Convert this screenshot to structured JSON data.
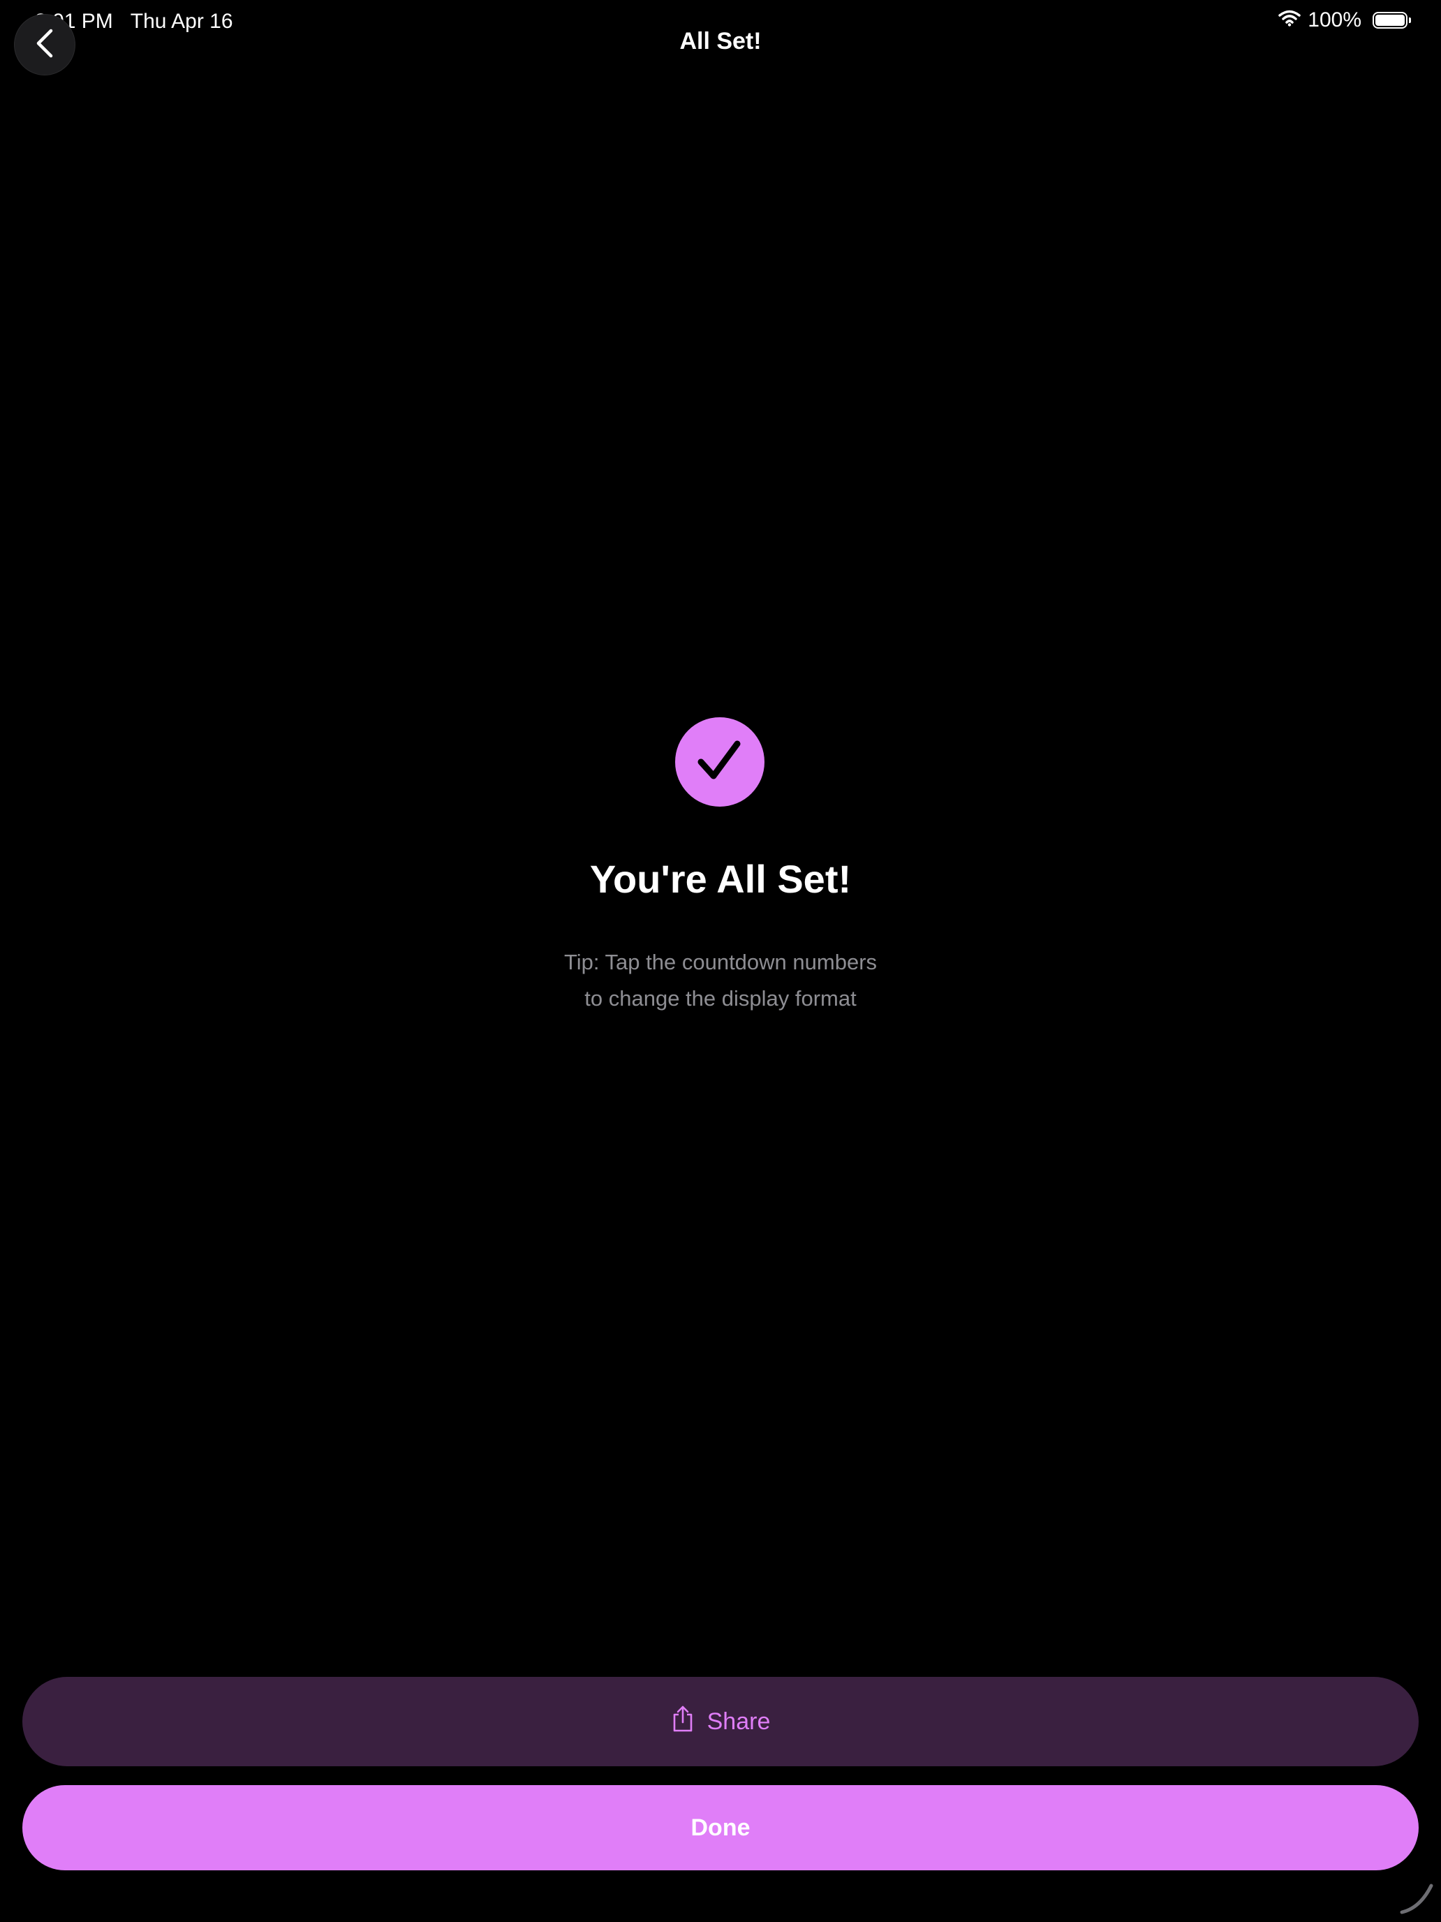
{
  "status_bar": {
    "time": "8:01 PM",
    "date": "Thu Apr 16",
    "battery": "100%",
    "battery_level_percent": 100
  },
  "nav": {
    "title": "All Set!",
    "back_icon": "chevron-left-icon"
  },
  "main": {
    "icon": "checkmark-icon",
    "headline": "You're All Set!",
    "tip_line1": "Tip: Tap the countdown numbers",
    "tip_line2": "to change the display format"
  },
  "actions": {
    "share_label": "Share",
    "share_icon": "share-icon",
    "done_label": "Done"
  },
  "colors": {
    "background": "#000000",
    "accent": "#e07ef8",
    "share_background": "#3a2040",
    "secondary_text": "#8e8e93"
  }
}
